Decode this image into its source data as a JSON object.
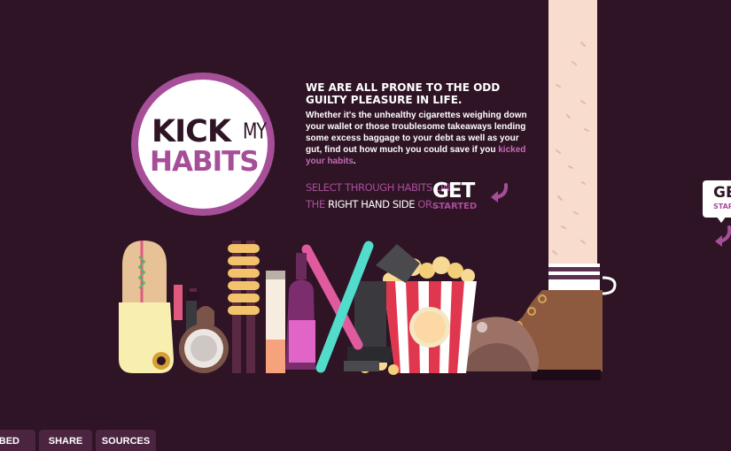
{
  "logo": {
    "kick": "KICK",
    "my": "MY",
    "habits": "HABITS"
  },
  "intro": {
    "heading": "WE ARE ALL PRONE TO THE ODD GUILTY PLEASURE IN LIFE.",
    "body_start": "Whether it's the unhealthy cigarettes weighing down your wallet or those troublesome takeaways lending some excess baggage to your debt as well as your gut, find out how much you could save if you ",
    "body_link": "kicked your habits",
    "body_end": "."
  },
  "select": {
    "line1": "SELECT THROUGH HABITS ON",
    "line2_the": "THE ",
    "line2_right": "RIGHT HAND SIDE",
    "line2_or": " OR..."
  },
  "get_started": {
    "get": "GET",
    "started": "STARTED"
  },
  "side_badge": {
    "get": "GET",
    "started": "STARTED"
  },
  "tabs": {
    "subscribed": "SUBSCRIBED",
    "share": "SHARE",
    "sources": "SOURCES"
  },
  "icons": {
    "curved_arrow": "curved-arrow-icon"
  },
  "colors": {
    "background": "#2f1426",
    "accent": "#a64e98",
    "text": "#ffffff",
    "tab": "#4b2440"
  }
}
